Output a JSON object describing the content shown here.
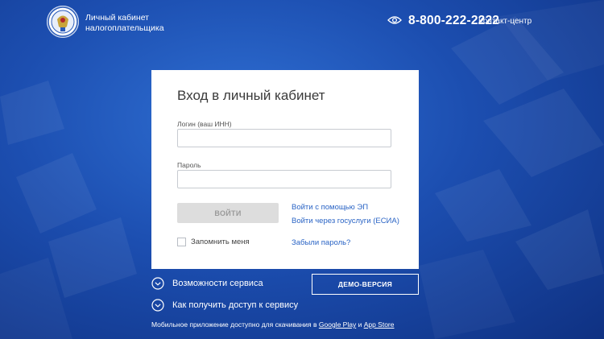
{
  "header": {
    "brand_line1": "Личный кабинет",
    "brand_line2": "налогоплательщика",
    "phone": "8-800-222-2222",
    "contact_label": "Контакт-центр",
    "eye_icon": "eye-icon",
    "logo_icon": "fns-emblem"
  },
  "login": {
    "title": "Вход в личный кабинет",
    "login_label": "Логин (ваш ИНН)",
    "login_value": "",
    "password_label": "Пароль",
    "password_value": "",
    "submit_label": "ВОЙТИ",
    "link_ep": "Войти с помощью ЭП",
    "link_esia": "Войти через госуслуги (ЕСИА)",
    "remember_label": "Запомнить меня",
    "forgot_label": "Забыли пароль?"
  },
  "below": {
    "features_label": "Возможности сервиса",
    "access_label": "Как получить доступ к сервису",
    "demo_label": "ДЕМО-ВЕРСИЯ",
    "mobile_prefix": "Мобильное приложение доступно для скачивания в ",
    "google_play": "Google Play",
    "and": " и ",
    "app_store": "App Store"
  },
  "colors": {
    "background": "#1c4eb0",
    "link": "#2a64c5",
    "button_disabled": "#dddddd"
  }
}
